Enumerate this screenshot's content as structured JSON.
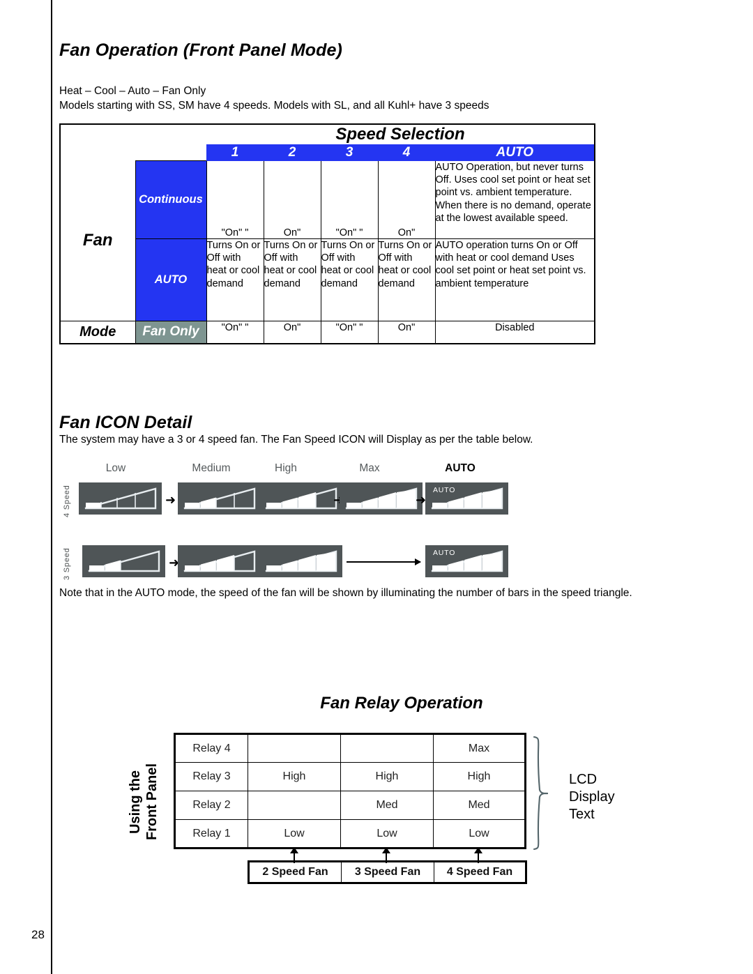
{
  "page": {
    "number": "28",
    "section_title": "Fan Operation (Front Panel Mode)",
    "intro_line1": "Heat – Cool – Auto – Fan Only",
    "intro_line2": "Models starting with SS, SM have 4 speeds. Models with SL, and all Kuhl+ have 3 speeds"
  },
  "speed_table": {
    "title": "Speed Selection",
    "columns": [
      "1",
      "2",
      "3",
      "4",
      "AUTO"
    ],
    "row_axis_label": "Fan",
    "mode_label": "Mode",
    "rows": [
      {
        "name": "Continuous",
        "cells": [
          "\"On\" \"",
          "On\"",
          "\"On\" \"",
          "On\""
        ],
        "auto": "AUTO Operation, but never turns Off. Uses cool set point or heat set point vs. ambient temperature. When there is no demand, operate at the lowest available speed."
      },
      {
        "name": "AUTO",
        "cells": [
          "Turns On or Off with heat or cool demand",
          "Turns On or Off with heat or cool demand",
          "Turns On or Off with heat or cool demand",
          "Turns On or Off with heat or cool demand"
        ],
        "auto": "AUTO operation turns On or Off with heat or cool demand Uses cool set point or heat set point vs. ambient temperature"
      },
      {
        "name": "Fan Only",
        "cells": [
          "\"On\" \"",
          "On\"",
          "\"On\" \"",
          "On\""
        ],
        "auto": "Disabled"
      }
    ],
    "colors": {
      "header_blue": "#2435f2",
      "fan_only_grey": "#7e9591"
    }
  },
  "icon_detail": {
    "title": "Fan ICON Detail",
    "description": "The system may have a 3 or 4 speed fan. The Fan Speed ICON will Display as per the table below.",
    "column_labels": [
      "Low",
      "Medium",
      "High",
      "Max",
      "AUTO"
    ],
    "row_labels": [
      "4 Speed",
      "3 Speed"
    ],
    "auto_badge": "AUTO",
    "note": "Note that in the AUTO mode, the speed of the fan will be shown by illuminating the number of bars in the speed triangle.",
    "icon_colors": {
      "background": "#4f5557",
      "outline": "#e8edf0",
      "fill": "#ffffff"
    },
    "row4_filled_bars": [
      1,
      2,
      3,
      4,
      4
    ],
    "row3_filled_bars": [
      1,
      2,
      3,
      3
    ],
    "bars_total_4speed": 4,
    "bars_total_3speed": 4
  },
  "relay_diagram": {
    "title": "Fan Relay Operation",
    "side_label_line1": "Using the",
    "side_label_line2": "Front Panel",
    "lcd_label_line1": "LCD",
    "lcd_label_line2": "Display",
    "lcd_label_line3": "Text",
    "relay_rows": [
      {
        "relay": "Relay 4",
        "values": [
          "",
          "",
          "Max"
        ]
      },
      {
        "relay": "Relay 3",
        "values": [
          "High",
          "High",
          "High"
        ]
      },
      {
        "relay": "Relay 2",
        "values": [
          "",
          "Med",
          "Med"
        ]
      },
      {
        "relay": "Relay 1",
        "values": [
          "Low",
          "Low",
          "Low"
        ]
      }
    ],
    "fan_columns": [
      "2 Speed Fan",
      "3 Speed Fan",
      "4 Speed Fan"
    ]
  }
}
